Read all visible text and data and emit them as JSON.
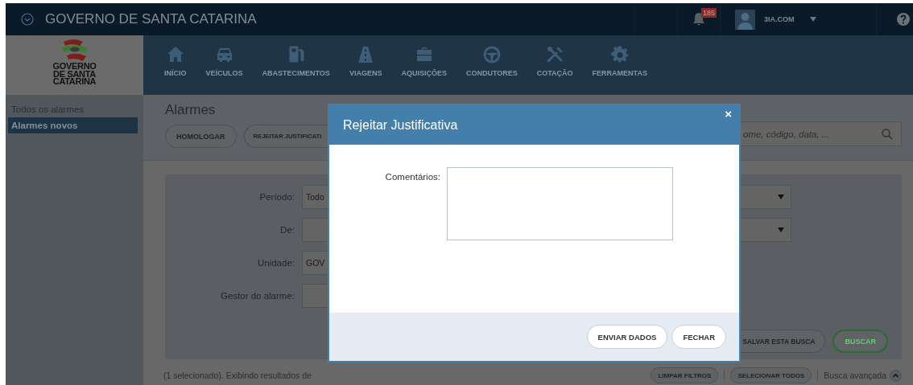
{
  "topbar": {
    "title": "GOVERNO DE SANTA CATARINA",
    "notifications": "185",
    "user": "3IA.COM"
  },
  "logo": {
    "lines": [
      "GOVERNO",
      "DE SANTA",
      "CATARINA"
    ]
  },
  "nav": [
    {
      "label": "INÍCIO"
    },
    {
      "label": "VEÍCULOS"
    },
    {
      "label": "ABASTECIMENTOS"
    },
    {
      "label": "VIAGENS"
    },
    {
      "label": "AQUISIÇÕES"
    },
    {
      "label": "CONDUTORES"
    },
    {
      "label": "COTAÇÃO"
    },
    {
      "label": "FERRAMENTAS"
    }
  ],
  "sidebar": {
    "items": [
      {
        "label": "Todos os alarmes",
        "selected": false
      },
      {
        "label": "Alarmes novos",
        "selected": true
      }
    ]
  },
  "page": {
    "title": "Alarmes",
    "actions": [
      "HOMOLOGAR",
      "REJEITAR JUSTIFICATI"
    ],
    "search": {
      "placeholder": "ome, código, data, ..."
    }
  },
  "filters": {
    "fields": [
      {
        "label": "Período:",
        "value": "Todo",
        "kind": "select"
      },
      {
        "label": "De:",
        "kind": "select"
      },
      {
        "label": "Unidade:",
        "value": "GOV",
        "kind": "input"
      },
      {
        "label": "Gestor do alarme:",
        "kind": "input"
      }
    ],
    "buttons": [
      {
        "label": "SALVAR ESTA BUSCA",
        "kind": "default"
      },
      {
        "label": "BUSCAR",
        "kind": "primary"
      }
    ]
  },
  "results": {
    "summary": "(1 selecionado). Exibindo resultados de",
    "buttons": [
      "LIMPAR FILTROS",
      "SELECIONAR TODOS"
    ],
    "advanced": "Busca avançada"
  },
  "modal": {
    "title": "Rejeitar Justificativa",
    "close": "×",
    "comment_label": "Comentários:",
    "buttons": [
      "ENVIAR DADOS",
      "FECHAR"
    ]
  }
}
